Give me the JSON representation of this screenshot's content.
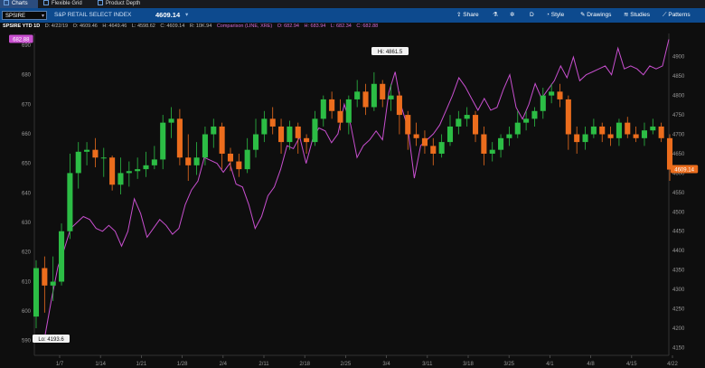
{
  "tabs": [
    {
      "label": "Charts",
      "active": true
    },
    {
      "label": "Flexible Grid",
      "active": false
    },
    {
      "label": "Product Depth",
      "active": false
    }
  ],
  "toolbar": {
    "symbol": "SPSIRE",
    "description": "S&P RETAIL SELECT INDEX",
    "price": "4609.14",
    "share_label": "Share",
    "day_label": "D",
    "style_label": "Style",
    "drawings_label": "Drawings",
    "studies_label": "Studies",
    "patterns_label": "Patterns"
  },
  "infobar": {
    "title": "SPSIRE YTD 1D",
    "date": "D: 4/22/19",
    "open": "O: 4609.46",
    "high": "H: 4649.46",
    "low": "L: 4598.62",
    "close": "C: 4609.14",
    "range": "R: 10K.94",
    "comparison": "Comparison (LINE, XRE)",
    "cmp_open": "O: 682.94",
    "cmp_high": "H: 683.94",
    "cmp_low": "L: 682.34",
    "cmp_close": "C: 682.88"
  },
  "colors": {
    "up": "#2cbd45",
    "down": "#ec6d1d",
    "comparison": "#c84fcf",
    "toolbar": "#0d4a8e"
  },
  "chart_data": {
    "type": "candlestick",
    "x_tick_labels": [
      "1/7",
      "1/14",
      "1/21",
      "1/28",
      "2/4",
      "2/11",
      "2/18",
      "2/25",
      "3/4",
      "3/11",
      "3/18",
      "3/25",
      "4/1",
      "4/8",
      "4/15",
      "4/22"
    ],
    "left_axis": {
      "min": 585,
      "max": 694,
      "ticks": [
        590,
        600,
        610,
        620,
        630,
        640,
        650,
        660,
        670,
        680,
        690
      ]
    },
    "right_axis": {
      "min": 4130,
      "max": 4960,
      "ticks": [
        4150,
        4200,
        4250,
        4300,
        4350,
        4400,
        4450,
        4500,
        4550,
        4600,
        4650,
        4700,
        4750,
        4800,
        4850,
        4900
      ]
    },
    "left_last_label": "682.88",
    "right_last_label": "4609.14",
    "high_annotation": "Hi: 4861.5",
    "low_annotation": "Lo: 4193.6",
    "candles": [
      [
        4230,
        4355,
        4375,
        4200
      ],
      [
        4355,
        4310,
        4385,
        4240
      ],
      [
        4310,
        4320,
        4385,
        4270
      ],
      [
        4320,
        4450,
        4470,
        4310
      ],
      [
        4450,
        4600,
        4650,
        4430
      ],
      [
        4600,
        4655,
        4680,
        4560
      ],
      [
        4655,
        4660,
        4680,
        4620
      ],
      [
        4660,
        4640,
        4690,
        4615
      ],
      [
        4640,
        4640,
        4665,
        4590
      ],
      [
        4640,
        4570,
        4645,
        4555
      ],
      [
        4570,
        4600,
        4640,
        4545
      ],
      [
        4600,
        4605,
        4630,
        4565
      ],
      [
        4605,
        4610,
        4640,
        4585
      ],
      [
        4610,
        4620,
        4655,
        4590
      ],
      [
        4620,
        4635,
        4670,
        4610
      ],
      [
        4635,
        4730,
        4750,
        4610
      ],
      [
        4730,
        4740,
        4770,
        4690
      ],
      [
        4740,
        4640,
        4765,
        4620
      ],
      [
        4640,
        4620,
        4700,
        4580
      ],
      [
        4620,
        4640,
        4680,
        4595
      ],
      [
        4640,
        4700,
        4720,
        4620
      ],
      [
        4700,
        4720,
        4740,
        4665
      ],
      [
        4720,
        4650,
        4730,
        4610
      ],
      [
        4650,
        4630,
        4665,
        4605
      ],
      [
        4630,
        4610,
        4650,
        4590
      ],
      [
        4610,
        4660,
        4690,
        4600
      ],
      [
        4660,
        4700,
        4740,
        4640
      ],
      [
        4700,
        4740,
        4760,
        4680
      ],
      [
        4740,
        4720,
        4770,
        4700
      ],
      [
        4720,
        4680,
        4740,
        4650
      ],
      [
        4680,
        4720,
        4735,
        4660
      ],
      [
        4720,
        4690,
        4730,
        4650
      ],
      [
        4690,
        4680,
        4700,
        4650
      ],
      [
        4680,
        4740,
        4760,
        4670
      ],
      [
        4740,
        4790,
        4800,
        4720
      ],
      [
        4790,
        4760,
        4810,
        4740
      ],
      [
        4760,
        4730,
        4790,
        4710
      ],
      [
        4730,
        4790,
        4800,
        4700
      ],
      [
        4790,
        4810,
        4840,
        4770
      ],
      [
        4810,
        4770,
        4830,
        4750
      ],
      [
        4770,
        4830,
        4860,
        4760
      ],
      [
        4830,
        4790,
        4840,
        4770
      ],
      [
        4790,
        4800,
        4830,
        4760
      ],
      [
        4800,
        4750,
        4810,
        4700
      ],
      [
        4750,
        4700,
        4760,
        4660
      ],
      [
        4700,
        4690,
        4730,
        4670
      ],
      [
        4690,
        4670,
        4710,
        4650
      ],
      [
        4670,
        4650,
        4690,
        4620
      ],
      [
        4650,
        4680,
        4700,
        4640
      ],
      [
        4680,
        4720,
        4750,
        4670
      ],
      [
        4720,
        4740,
        4760,
        4700
      ],
      [
        4740,
        4750,
        4770,
        4720
      ],
      [
        4750,
        4700,
        4760,
        4680
      ],
      [
        4700,
        4650,
        4720,
        4620
      ],
      [
        4650,
        4660,
        4680,
        4630
      ],
      [
        4660,
        4690,
        4700,
        4640
      ],
      [
        4690,
        4700,
        4720,
        4670
      ],
      [
        4700,
        4730,
        4760,
        4690
      ],
      [
        4730,
        4740,
        4760,
        4710
      ],
      [
        4740,
        4760,
        4770,
        4720
      ],
      [
        4760,
        4800,
        4820,
        4740
      ],
      [
        4800,
        4810,
        4830,
        4780
      ],
      [
        4810,
        4790,
        4830,
        4770
      ],
      [
        4790,
        4700,
        4800,
        4660
      ],
      [
        4700,
        4680,
        4720,
        4650
      ],
      [
        4680,
        4700,
        4720,
        4660
      ],
      [
        4700,
        4720,
        4740,
        4690
      ],
      [
        4720,
        4700,
        4730,
        4680
      ],
      [
        4700,
        4690,
        4720,
        4670
      ],
      [
        4690,
        4730,
        4740,
        4670
      ],
      [
        4730,
        4700,
        4745,
        4690
      ],
      [
        4700,
        4690,
        4720,
        4680
      ],
      [
        4690,
        4710,
        4730,
        4670
      ],
      [
        4710,
        4720,
        4740,
        4700
      ],
      [
        4720,
        4690,
        4730,
        4680
      ],
      [
        4690,
        4609,
        4700,
        4580
      ]
    ],
    "comparison_series": [
      592,
      604,
      615,
      621,
      628,
      630,
      632,
      631,
      628,
      627,
      629,
      627,
      622,
      627,
      638,
      633,
      625,
      628,
      631,
      629,
      626,
      628,
      636,
      641,
      644,
      652,
      651,
      650,
      647,
      650,
      643,
      642,
      636,
      628,
      632,
      639,
      642,
      648,
      656,
      655,
      659,
      650,
      658,
      662,
      661,
      657,
      660,
      670,
      663,
      652,
      656,
      658,
      661,
      658,
      674,
      681,
      669,
      662,
      645,
      656,
      658,
      660,
      663,
      668,
      673,
      679,
      676,
      672,
      668,
      672,
      668,
      669,
      675,
      680,
      669,
      665,
      670,
      677,
      672,
      675,
      678,
      683,
      679,
      686,
      678,
      680,
      681,
      682,
      683,
      680,
      689,
      682,
      683,
      682,
      680,
      683,
      682,
      683,
      692
    ]
  }
}
